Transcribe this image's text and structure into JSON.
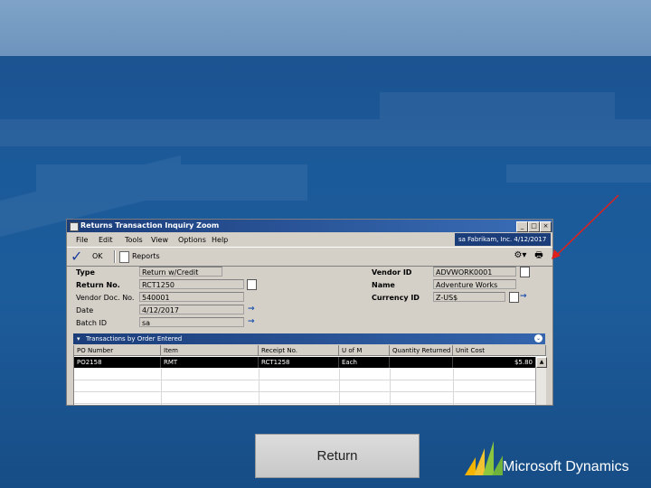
{
  "window": {
    "title": "Returns Transaction Inquiry Zoom",
    "controls": [
      "_",
      "□",
      "×"
    ]
  },
  "menu": [
    "File",
    "Edit",
    "Tools",
    "View",
    "Options",
    "Help"
  ],
  "user_info": "sa  Fabrikam, Inc. 4/12/2017",
  "toolbar": {
    "ok_label": "OK",
    "reports_label": "Reports"
  },
  "fields_left": [
    {
      "label": "Type",
      "value": "Return w/Credit",
      "bold": true
    },
    {
      "label": "Return No.",
      "value": "RCT1250",
      "bold": true
    },
    {
      "label": "Vendor Doc. No.",
      "value": "540001",
      "bold": false
    },
    {
      "label": "Date",
      "value": "4/12/2017",
      "bold": false
    },
    {
      "label": "Batch ID",
      "value": "sa",
      "bold": false
    }
  ],
  "fields_right": [
    {
      "label": "Vendor ID",
      "value": "ADVWORK0001"
    },
    {
      "label": "Name",
      "value": "Adventure Works"
    },
    {
      "label": "Currency ID",
      "value": "Z-US$"
    }
  ],
  "grid": {
    "header_title": "Transactions by Order Entered",
    "columns": [
      "PO Number",
      "Item",
      "Receipt No.",
      "U of M",
      "Quantity Returned",
      "Unit Cost"
    ],
    "rows": [
      [
        "PO2158",
        "RMT",
        "RCT1258",
        "Each",
        "",
        "$5.80"
      ],
      [
        "",
        "",
        "",
        "",
        "",
        ""
      ],
      [
        "",
        "",
        "",
        "",
        "",
        ""
      ],
      [
        "",
        "",
        "",
        "",
        "",
        ""
      ]
    ]
  },
  "slide": {
    "return_label": "Return",
    "brand": "Microsoft Dynamics"
  },
  "colors": {
    "background": "#1b5a9a",
    "top_band": "#7fa3c8",
    "window_title": "#1b3d7a",
    "annotation_arrow": "#e0201c"
  }
}
